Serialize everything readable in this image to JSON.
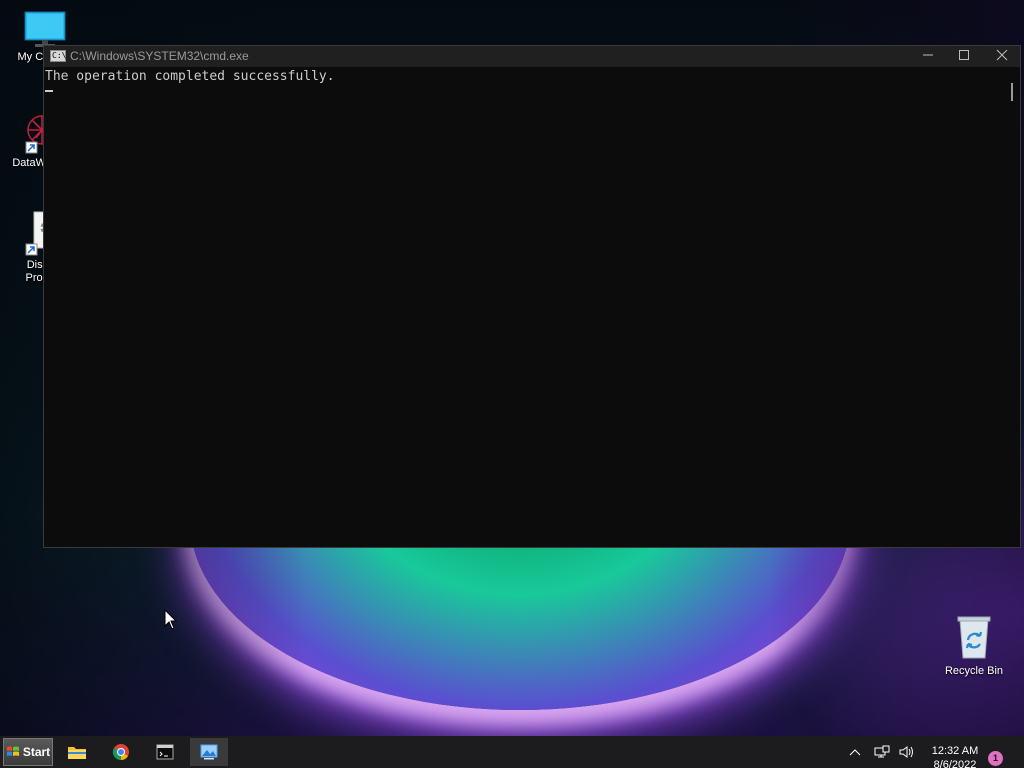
{
  "desktop": {
    "icons": [
      {
        "label": "My Com",
        "icon": "computer-icon"
      },
      {
        "label": "DataWa",
        "icon": "datawarehouse-shortcut-icon"
      },
      {
        "label": "Displa Proper",
        "icon": "display-properties-shortcut-icon"
      },
      {
        "label": "Recycle Bin",
        "icon": "recycle-bin-icon"
      }
    ]
  },
  "cmd_window": {
    "title": "C:\\Windows\\SYSTEM32\\cmd.exe",
    "output_line": "The operation completed successfully.",
    "controls": {
      "minimize": "minimize-icon",
      "maximize": "maximize-icon",
      "close": "close-icon"
    }
  },
  "taskbar": {
    "start_label": "Start",
    "pinned": [
      "file-explorer-icon",
      "chrome-icon",
      "terminal-icon",
      "photos-icon"
    ],
    "active_app": "photos-icon",
    "clock": {
      "time": "12:32 AM",
      "date": "8/6/2022"
    },
    "notification_count": "1"
  },
  "colors": {
    "console_bg": "#0c0c0c",
    "console_text": "#cccccc",
    "taskbar_bg": "#1c1c1e",
    "titlebar_bg": "#202020"
  }
}
